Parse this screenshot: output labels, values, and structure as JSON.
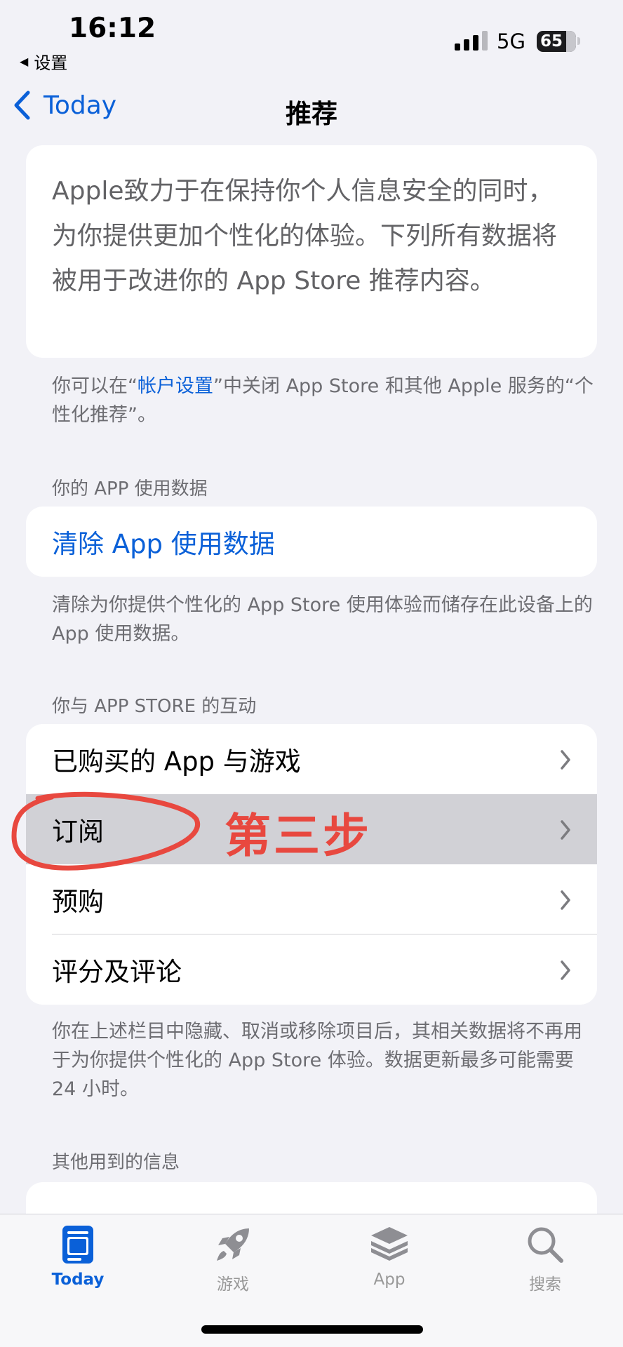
{
  "status": {
    "time": "16:12",
    "back_app": "设置",
    "network": "5G",
    "battery": "65"
  },
  "nav": {
    "back_label": "Today",
    "title": "推荐"
  },
  "intro": {
    "text": "Apple致力于在保持你个人信息安全的同时，为你提供更加个性化的体验。下列所有数据将被用于改进你的 App Store 推荐内容。"
  },
  "settings_note": {
    "prefix": "你可以在“",
    "link": "帐户设置",
    "suffix": "”中关闭 App Store 和其他 Apple 服务的“个性化推荐”。"
  },
  "usage_section": {
    "header": "你的 APP 使用数据",
    "clear_label": "清除 App 使用数据",
    "footer": "清除为你提供个性化的 App Store 使用体验而储存在此设备上的 App 使用数据。"
  },
  "interaction_section": {
    "header": "你与 APP STORE 的互动",
    "items": [
      {
        "label": "已购买的 App 与游戏"
      },
      {
        "label": "订阅"
      },
      {
        "label": "预购"
      },
      {
        "label": "评分及评论"
      }
    ],
    "footer": "你在上述栏目中隐藏、取消或移除项目后，其相关数据将不再用于为你提供个性化的 App Store 体验。数据更新最多可能需要 24 小时。"
  },
  "other_section": {
    "header": "其他用到的信息"
  },
  "annotation": {
    "text": "第三步",
    "color": "#e8483f"
  },
  "tabs": [
    {
      "label": "Today",
      "icon": "today-icon",
      "active": true
    },
    {
      "label": "游戏",
      "icon": "rocket-icon",
      "active": false
    },
    {
      "label": "App",
      "icon": "layers-icon",
      "active": false
    },
    {
      "label": "搜索",
      "icon": "search-icon",
      "active": false
    }
  ],
  "colors": {
    "accent": "#0a60d8",
    "background": "#f2f2f7",
    "highlight": "#d1d1d6"
  }
}
